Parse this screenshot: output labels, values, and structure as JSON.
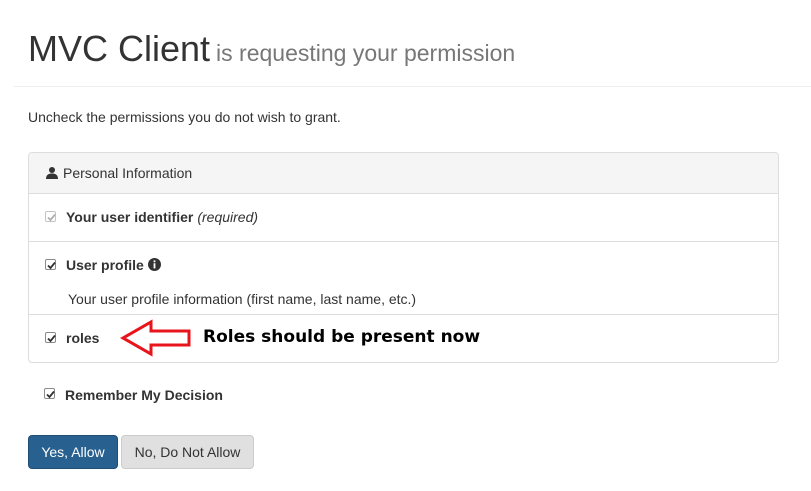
{
  "header": {
    "client_name": "MVC Client",
    "subtitle": "is requesting your permission"
  },
  "instruction": "Uncheck the permissions you do not wish to grant.",
  "panel": {
    "heading": "Personal Information",
    "heading_icon": "user-icon",
    "scopes": [
      {
        "label": "Your user identifier",
        "note": "(required)",
        "checked": true,
        "disabled": true
      },
      {
        "label": "User profile",
        "icon": "info-sign-icon",
        "description": "Your user profile information (first name, last name, etc.)",
        "checked": true,
        "disabled": false
      },
      {
        "label": "roles",
        "checked": true,
        "disabled": false
      }
    ]
  },
  "annotation": {
    "text": "Roles should be present now",
    "arrow_color": "#e8141b"
  },
  "remember": {
    "label": "Remember My Decision",
    "checked": true
  },
  "buttons": {
    "allow": "Yes, Allow",
    "deny": "No, Do Not Allow"
  },
  "colors": {
    "primary": "#286090",
    "default_button": "#e0e0e0",
    "panel_heading": "#f5f5f5"
  }
}
